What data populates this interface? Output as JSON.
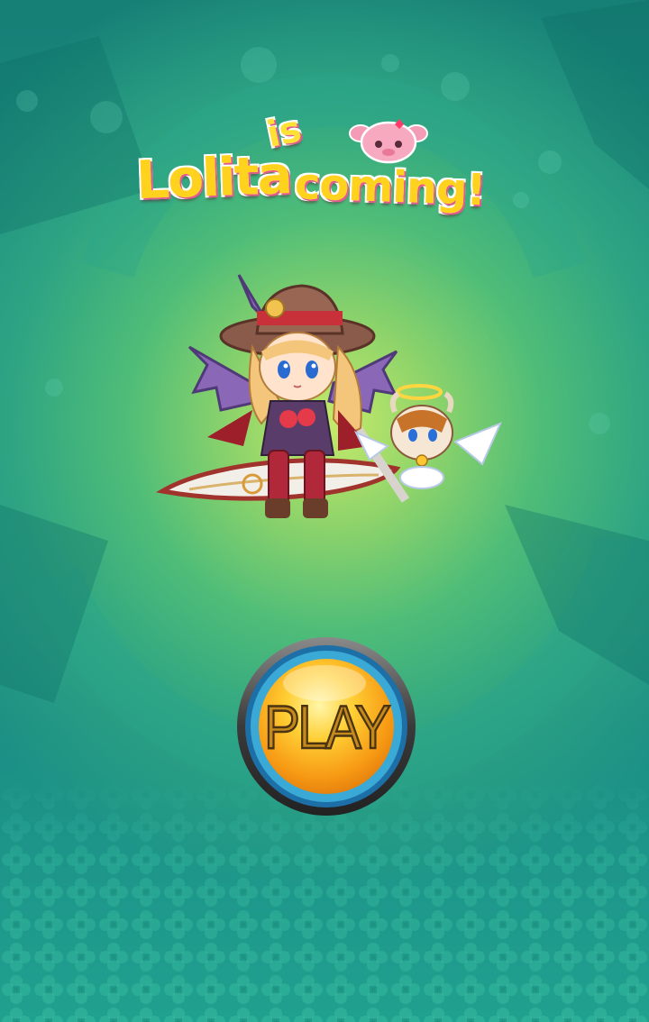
{
  "title": {
    "part1": "Lolita",
    "part2": "is",
    "part3": "coming!",
    "mascot_icon": "pink-pig-icon"
  },
  "hero": {
    "character": "winged-witch-girl-with-scythe",
    "companion": "angel-bull-mascot"
  },
  "play_button": {
    "label": "PLAY"
  },
  "colors": {
    "background_center": "#c6ea6a",
    "background_edge": "#167f76",
    "title_fill": "#ffd21e",
    "button_core": "#ffa41a",
    "button_ring": "#3aa9d6",
    "button_rim": "#3a3a3a"
  }
}
